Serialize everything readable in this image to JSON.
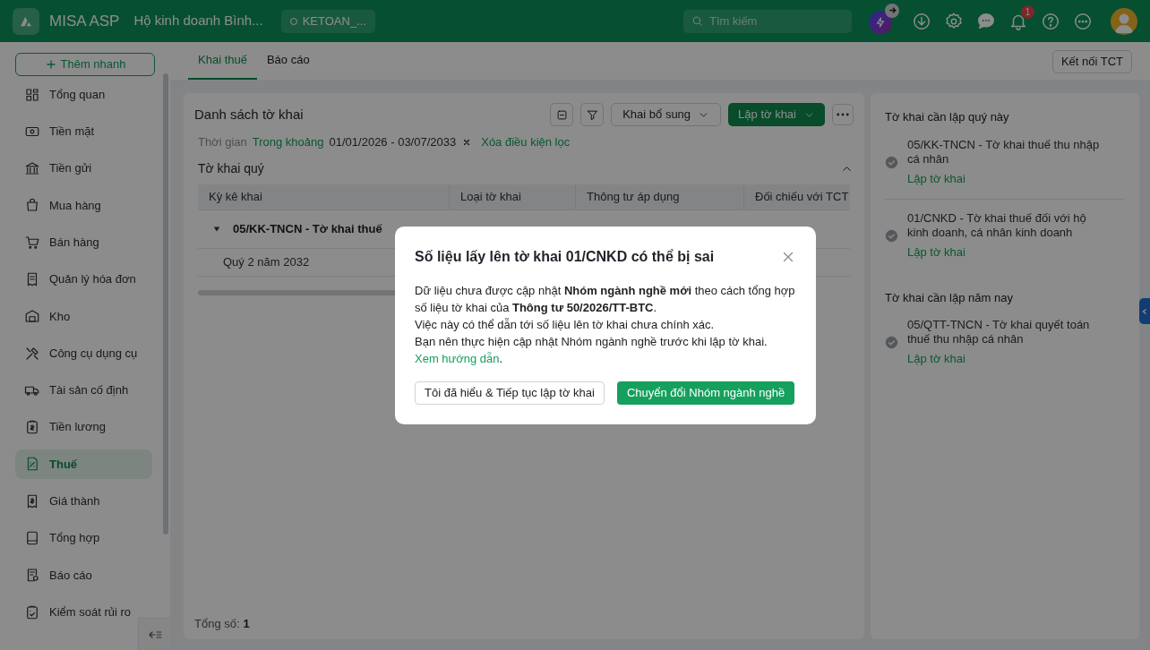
{
  "header": {
    "app_name": "MISA ASP",
    "company": "Hộ kinh doanh Bình...",
    "database": "KETOAN_...",
    "search_placeholder": "Tìm kiếm",
    "notification_count": "1"
  },
  "sidebar": {
    "quick_add": "Thêm nhanh",
    "items": [
      {
        "label": "Tổng quan",
        "selected": false
      },
      {
        "label": "Tiền mặt",
        "selected": false
      },
      {
        "label": "Tiền gửi",
        "selected": false
      },
      {
        "label": "Mua hàng",
        "selected": false
      },
      {
        "label": "Bán hàng",
        "selected": false
      },
      {
        "label": "Quản lý hóa đơn",
        "selected": false
      },
      {
        "label": "Kho",
        "selected": false
      },
      {
        "label": "Công cụ dụng cụ",
        "selected": false
      },
      {
        "label": "Tài sản cố định",
        "selected": false
      },
      {
        "label": "Tiền lương",
        "selected": false
      },
      {
        "label": "Thuế",
        "selected": true
      },
      {
        "label": "Giá thành",
        "selected": false
      },
      {
        "label": "Tổng hợp",
        "selected": false
      },
      {
        "label": "Báo cáo",
        "selected": false
      },
      {
        "label": "Kiểm soát rủi ro",
        "selected": false
      }
    ]
  },
  "tabs": [
    {
      "label": "Khai thuế",
      "selected": true
    },
    {
      "label": "Báo cáo",
      "selected": false
    }
  ],
  "connect_button": "Kết nối TCT",
  "list": {
    "title": "Danh sách tờ khai",
    "supplement_button": "Khai bổ sung",
    "create_button": "Lập tờ khai",
    "filter": {
      "label": "Thời gian",
      "mode": "Trong khoảng",
      "range": "01/01/2026 - 03/07/2033",
      "clear": "Xóa điều kiện lọc"
    },
    "section": {
      "title": "Tờ khai quý",
      "expanded": true
    },
    "table": {
      "columns": [
        "Kỳ kê khai",
        "Loại tờ khai",
        "Thông tư áp dụng",
        "Đối chiếu với TCT"
      ],
      "groups": [
        {
          "title": "05/KK-TNCN - Tờ khai thuế",
          "expanded": true,
          "rows": [
            {
              "period": "Quý 2 năm 2032"
            }
          ]
        }
      ]
    },
    "total_label": "Tổng số:",
    "total_value": "1"
  },
  "right_panel": {
    "sections": [
      {
        "title": "Tờ khai cần lập quý này",
        "items": [
          {
            "name": "05/KK-TNCN - Tờ khai thuế thu nhập cá nhân",
            "action": "Lập tờ khai"
          },
          {
            "name": "01/CNKD - Tờ khai thuế đối với hộ kinh doanh, cá nhân kinh doanh",
            "action": "Lập tờ khai"
          }
        ]
      },
      {
        "title": "Tờ khai cần lập năm nay",
        "items": [
          {
            "name": "05/QTT-TNCN - Tờ khai quyết toán thuế thu nhập cá nhân",
            "action": "Lập tờ khai"
          }
        ]
      }
    ]
  },
  "dialog": {
    "title": "Số liệu lấy lên tờ khai 01/CNKD có thể bị sai",
    "body": [
      "Dữ liệu chưa được cập nhật **Nhóm ngành nghề mới** theo cách tổng hợp số liệu tờ khai của **Thông tư 50/2026/TT-BTC**.",
      "Việc này có thể dẫn tới số liệu lên tờ khai chưa chính xác.",
      "Bạn nên thực hiện cập nhật Nhóm ngành nghề trước khi lập tờ khai."
    ],
    "link": "Xem hướng dẫn",
    "link_suffix": ".",
    "secondary_button": "Tôi đã hiểu & Tiếp tục lập tờ khai",
    "primary_button": "Chuyển đổi Nhóm ngành nghề"
  }
}
